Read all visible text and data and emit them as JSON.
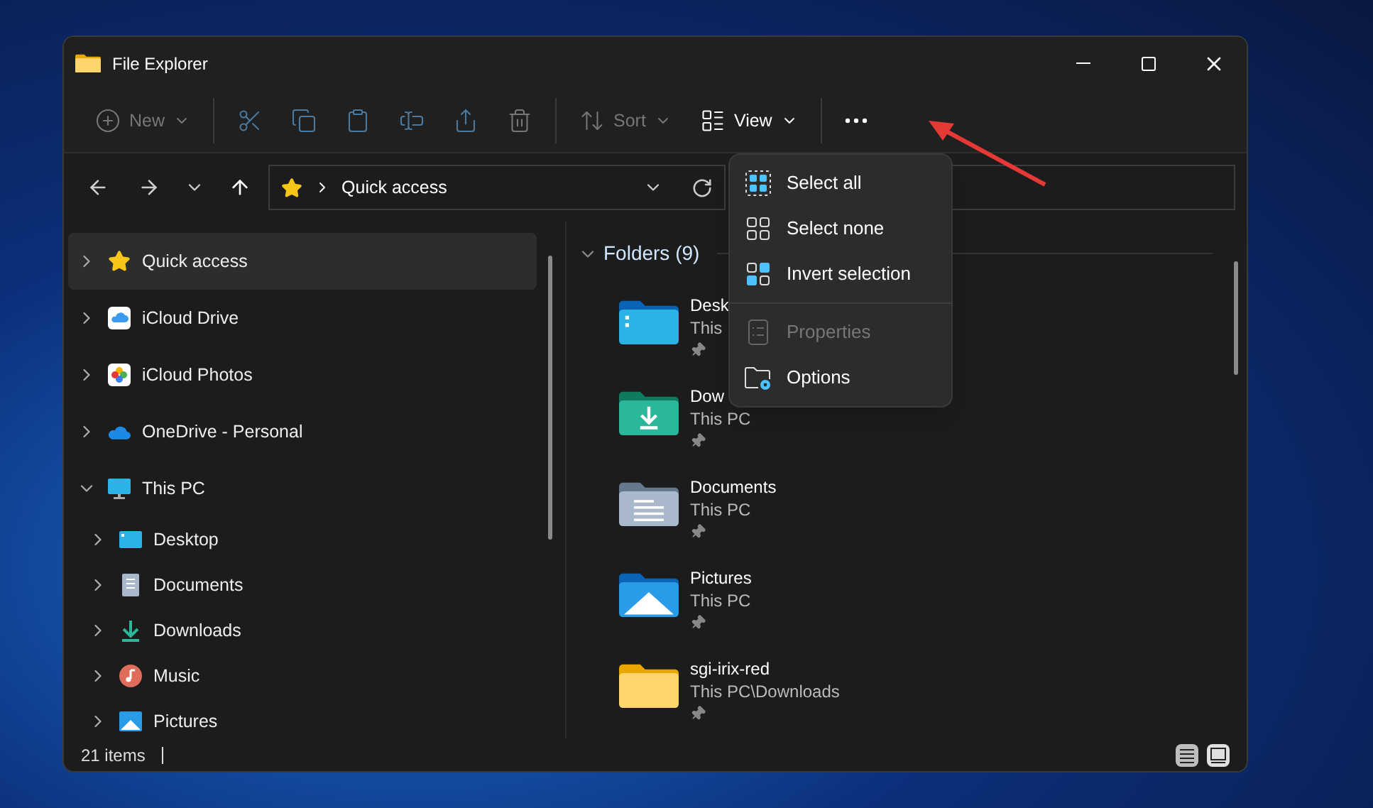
{
  "window": {
    "title": "File Explorer"
  },
  "toolbar": [
    {
      "kind": "new",
      "label": "New",
      "disabled": true
    },
    {
      "kind": "cut",
      "disabled": true
    },
    {
      "kind": "copy",
      "disabled": true
    },
    {
      "kind": "paste",
      "disabled": true
    },
    {
      "kind": "rename",
      "disabled": true
    },
    {
      "kind": "share",
      "disabled": true
    },
    {
      "kind": "delete",
      "disabled": true
    },
    {
      "kind": "sort",
      "label": "Sort",
      "disabled": true
    },
    {
      "kind": "view",
      "label": "View",
      "disabled": false
    },
    {
      "kind": "more",
      "disabled": false
    }
  ],
  "address": {
    "location": "Quick access"
  },
  "sidebar": {
    "items": [
      {
        "label": "Quick access",
        "kind": "star",
        "selected": true,
        "expanded": false
      },
      {
        "label": "iCloud Drive",
        "kind": "icloud",
        "selected": false,
        "expanded": false
      },
      {
        "label": "iCloud Photos",
        "kind": "photos",
        "selected": false,
        "expanded": false
      },
      {
        "label": "OneDrive - Personal",
        "kind": "onedrive",
        "selected": false,
        "expanded": false
      },
      {
        "label": "This PC",
        "kind": "pc",
        "selected": false,
        "expanded": true,
        "children": [
          {
            "label": "Desktop",
            "kind": "desktop",
            "selected": false,
            "expanded": false
          },
          {
            "label": "Documents",
            "kind": "documents",
            "selected": false,
            "expanded": false
          },
          {
            "label": "Downloads",
            "kind": "downloads",
            "selected": false,
            "expanded": false
          },
          {
            "label": "Music",
            "kind": "music",
            "selected": false,
            "expanded": false
          },
          {
            "label": "Pictures",
            "kind": "pictures",
            "selected": false,
            "expanded": false
          }
        ]
      }
    ]
  },
  "content": {
    "group": {
      "title": "Folders (9)",
      "expanded": true
    },
    "folders": [
      {
        "name": "Desk",
        "location": "This",
        "kind": "desktop",
        "pinned": true
      },
      {
        "name": "Dow",
        "location": "This PC",
        "kind": "downloads",
        "pinned": true
      },
      {
        "name": "Documents",
        "location": "This PC",
        "kind": "documents",
        "pinned": true
      },
      {
        "name": "Pictures",
        "location": "This PC",
        "kind": "pictures",
        "pinned": true
      },
      {
        "name": "sgi-irix-red",
        "location": "This PC\\Downloads",
        "kind": "plain",
        "pinned": true
      }
    ]
  },
  "menu": {
    "items": [
      {
        "label": "Select all",
        "kind": "select-all",
        "disabled": false
      },
      {
        "label": "Select none",
        "kind": "select-none",
        "disabled": false
      },
      {
        "label": "Invert selection",
        "kind": "invert",
        "disabled": false
      },
      {
        "label": "Properties",
        "kind": "properties",
        "disabled": true
      },
      {
        "label": "Options",
        "kind": "options",
        "disabled": false
      }
    ]
  },
  "status_bar": {
    "count": "21 items",
    "views": [
      {
        "kind": "details",
        "selected": false
      },
      {
        "kind": "tiles",
        "selected": true
      }
    ]
  }
}
